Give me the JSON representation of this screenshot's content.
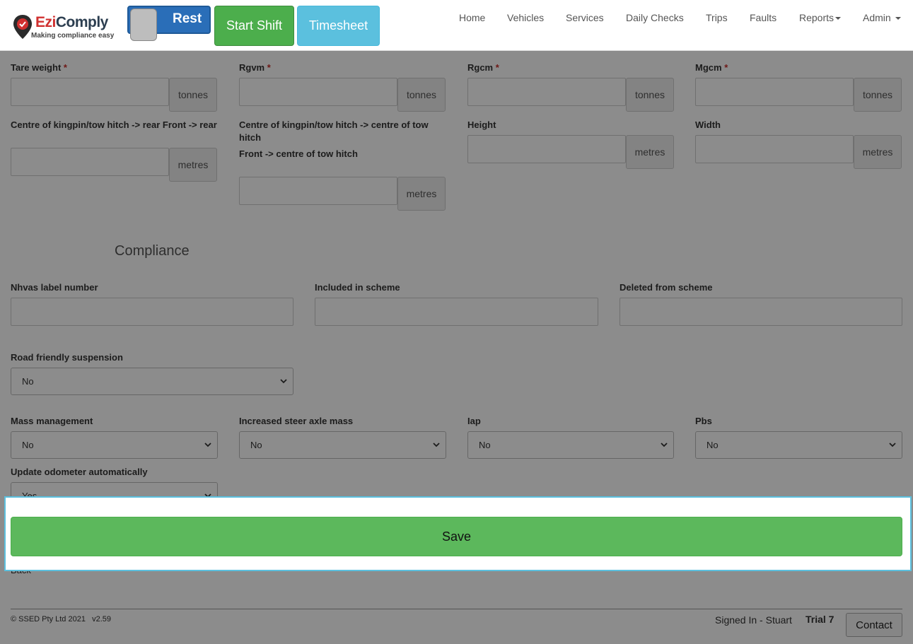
{
  "brand": {
    "name_part1": "Ezi",
    "name_part2": "Comply",
    "tagline": "Making compliance easy"
  },
  "header": {
    "rest_toggle_label": "Rest",
    "start_shift_label": "Start Shift",
    "timesheet_label": "Timesheet",
    "nav": [
      "Home",
      "Vehicles",
      "Services",
      "Daily Checks",
      "Trips",
      "Faults",
      "Reports",
      "Admin"
    ]
  },
  "form": {
    "tare_weight": {
      "label": "Tare weight",
      "required": "*",
      "unit": "tonnes",
      "value": ""
    },
    "rgvm": {
      "label": "Rgvm",
      "required": "*",
      "unit": "tonnes",
      "value": ""
    },
    "rgcm": {
      "label": "Rgcm",
      "required": "*",
      "unit": "tonnes",
      "value": ""
    },
    "mgcm": {
      "label": "Mgcm",
      "required": "*",
      "unit": "tonnes",
      "value": ""
    },
    "kingpin_rear": {
      "label": "Centre of kingpin/tow hitch -> rear Front -> rear",
      "unit": "metres",
      "value": ""
    },
    "kingpin_centre": {
      "label": "Centre of kingpin/tow hitch -> centre of tow hitch",
      "label_line2": "Front -> centre of tow hitch",
      "unit": "metres",
      "value": ""
    },
    "height": {
      "label": "Height",
      "unit": "metres",
      "value": ""
    },
    "width": {
      "label": "Width",
      "unit": "metres",
      "value": ""
    }
  },
  "compliance": {
    "title": "Compliance",
    "nhvas_label_number": {
      "label": "Nhvas label number",
      "value": ""
    },
    "included_in_scheme": {
      "label": "Included in scheme",
      "value": ""
    },
    "deleted_from_scheme": {
      "label": "Deleted from scheme",
      "value": ""
    },
    "road_friendly_suspension": {
      "label": "Road friendly suspension",
      "value": "No"
    },
    "mass_management": {
      "label": "Mass management",
      "value": "No"
    },
    "increased_steer_axle_mass": {
      "label": "Increased steer axle mass",
      "value": "No"
    },
    "iap": {
      "label": "Iap",
      "value": "No"
    },
    "pbs": {
      "label": "Pbs",
      "value": "No"
    },
    "update_odometer": {
      "label": "Update odometer automatically",
      "value": "Yes"
    }
  },
  "actions": {
    "save_label": "Save",
    "back_label": "Back"
  },
  "footer": {
    "copyright": "© SSED Pty Ltd 2021",
    "version": "v2.59",
    "signed_in": "Signed In - Stuart",
    "trial": "Trial 7",
    "contact_label": "Contact"
  },
  "colors": {
    "rest_toggle": "#2a6eb8",
    "start_shift": "#4cae4c",
    "timesheet": "#5bc0de",
    "save": "#5cb85c",
    "required": "#c9302c",
    "highlight_border": "#5bc0de"
  }
}
